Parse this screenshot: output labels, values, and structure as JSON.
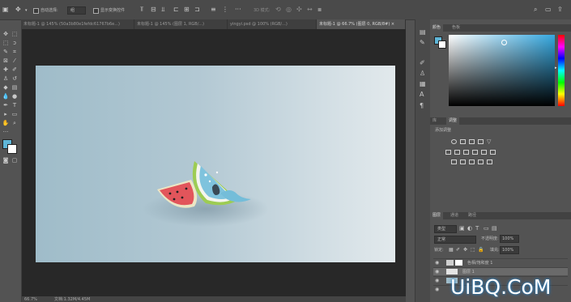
{
  "options_bar": {
    "auto_select_label": "自动选择:",
    "auto_select_value": "组",
    "show_transform_label": "显示变换控件",
    "mode_3d_label": "3D 模式:"
  },
  "tabs": [
    {
      "label": "未标题-1 @ 145% (50a3b80e1fefdc61767b6e...)"
    },
    {
      "label": "未标题-1 @ 145% (图层 1, RGB/...)"
    },
    {
      "label": "yingyi.psd @ 100% (RGB/...)"
    },
    {
      "label": "未标题-1 @ 66.7% (图层 0, RGB/8#) ×"
    }
  ],
  "color_panel": {
    "tabs": [
      "颜色",
      "色板"
    ],
    "foreground": "#5fb6d8",
    "background": "#ffffff",
    "hue_color": "#35a8e0"
  },
  "adjustments_panel": {
    "tabs": [
      "库",
      "调整"
    ],
    "add_adjustment_label": "添加调整"
  },
  "layers_panel": {
    "tabs": [
      "图层",
      "通道",
      "路径"
    ],
    "kind_filter": "类型",
    "blend_mode": "正常",
    "opacity_label": "不透明度:",
    "opacity_value": "100%",
    "lock_label": "锁定:",
    "fill_label": "填充:",
    "fill_value": "100%",
    "layers": [
      {
        "name": "色相/饱和度 1"
      },
      {
        "name": "图层 1"
      },
      {
        "name": ""
      }
    ]
  },
  "status": {
    "zoom": "66.7%",
    "doc_info": "文档:1.32M/4.45M"
  },
  "watermark": "UiBQ.CoM"
}
